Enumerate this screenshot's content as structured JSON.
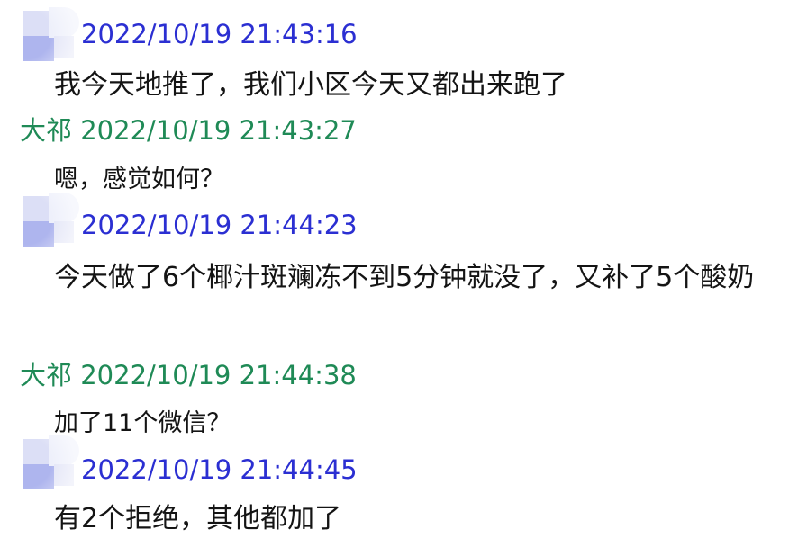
{
  "messages": [
    {
      "sender": "",
      "timestamp": "2022/10/19 21:43:16",
      "text": "我今天地推了，我们小区今天又都出来跑了"
    },
    {
      "sender": "大祁",
      "timestamp": "2022/10/19 21:43:27",
      "text": "嗯，感觉如何？"
    },
    {
      "sender": "",
      "timestamp": "2022/10/19 21:44:23",
      "text": "今天做了6个椰汁斑斓冻不到5分钟就没了，又补了5个酸奶"
    },
    {
      "sender": "大祁",
      "timestamp": "2022/10/19 21:44:38",
      "text": "加了11个微信？"
    },
    {
      "sender": "",
      "timestamp": "2022/10/19 21:44:45",
      "text": "有2个拒绝，其他都加了"
    }
  ],
  "colors": {
    "self_header": "#2b2fd2",
    "other_header": "#1f8a56",
    "message_text": "#141414"
  }
}
